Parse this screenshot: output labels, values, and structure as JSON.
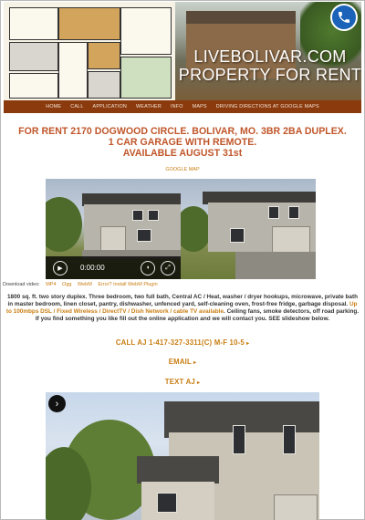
{
  "banner": {
    "title_line1": "LIVEBOLIVAR.COM",
    "title_line2": "PROPERTY FOR RENT",
    "phone_icon": "phone-icon"
  },
  "nav": {
    "items": [
      "HOME",
      "CALL",
      "APPLICATION",
      "WEATHER",
      "INFO",
      "MAPS",
      "DRIVING DIRECTIONS AT GOOGLE MAPS"
    ]
  },
  "headline": {
    "line1": "FOR RENT 2170 DOGWOOD CIRCLE. BOLIVAR, MO. 3BR 2BA DUPLEX.",
    "line2": "1 CAR GARAGE WITH REMOTE.",
    "line3": "AVAILABLE AUGUST 31st"
  },
  "google_map": "GOOGLE MAP",
  "video": {
    "time": "0:00:00"
  },
  "downloads": {
    "label": "Download video:",
    "links": [
      "MP4",
      "Ogg",
      "WebM",
      "Error? Install WebM Plugin"
    ]
  },
  "description": {
    "text1": "1800 sq. ft. two story duplex. Three bedroom, two full bath, Central AC / Heat, washer / dryer hookups, microwave, private bath in master bedroom, linen closet, pantry, dishwasher, unfenced yard, self-cleaning oven, frost-free fridge, garbage disposal. ",
    "highlight": "Up to 100mbps DSL / Fixed Wireless / DirectTV / Dish Network / cable TV available",
    "text2": ". Ceiling fans, smoke detectors, off road parking. If you find something you like fill out the online application and we will contact you. SEE slideshow below."
  },
  "cta": {
    "call": "CALL AJ 1-417-327-3311(C) M-F 10-5",
    "email": "EMAIL",
    "text": "TEXT AJ"
  },
  "colors": {
    "nav_bg": "#8b3a0e",
    "headline": "#c0562a",
    "accent": "#c87d12"
  }
}
